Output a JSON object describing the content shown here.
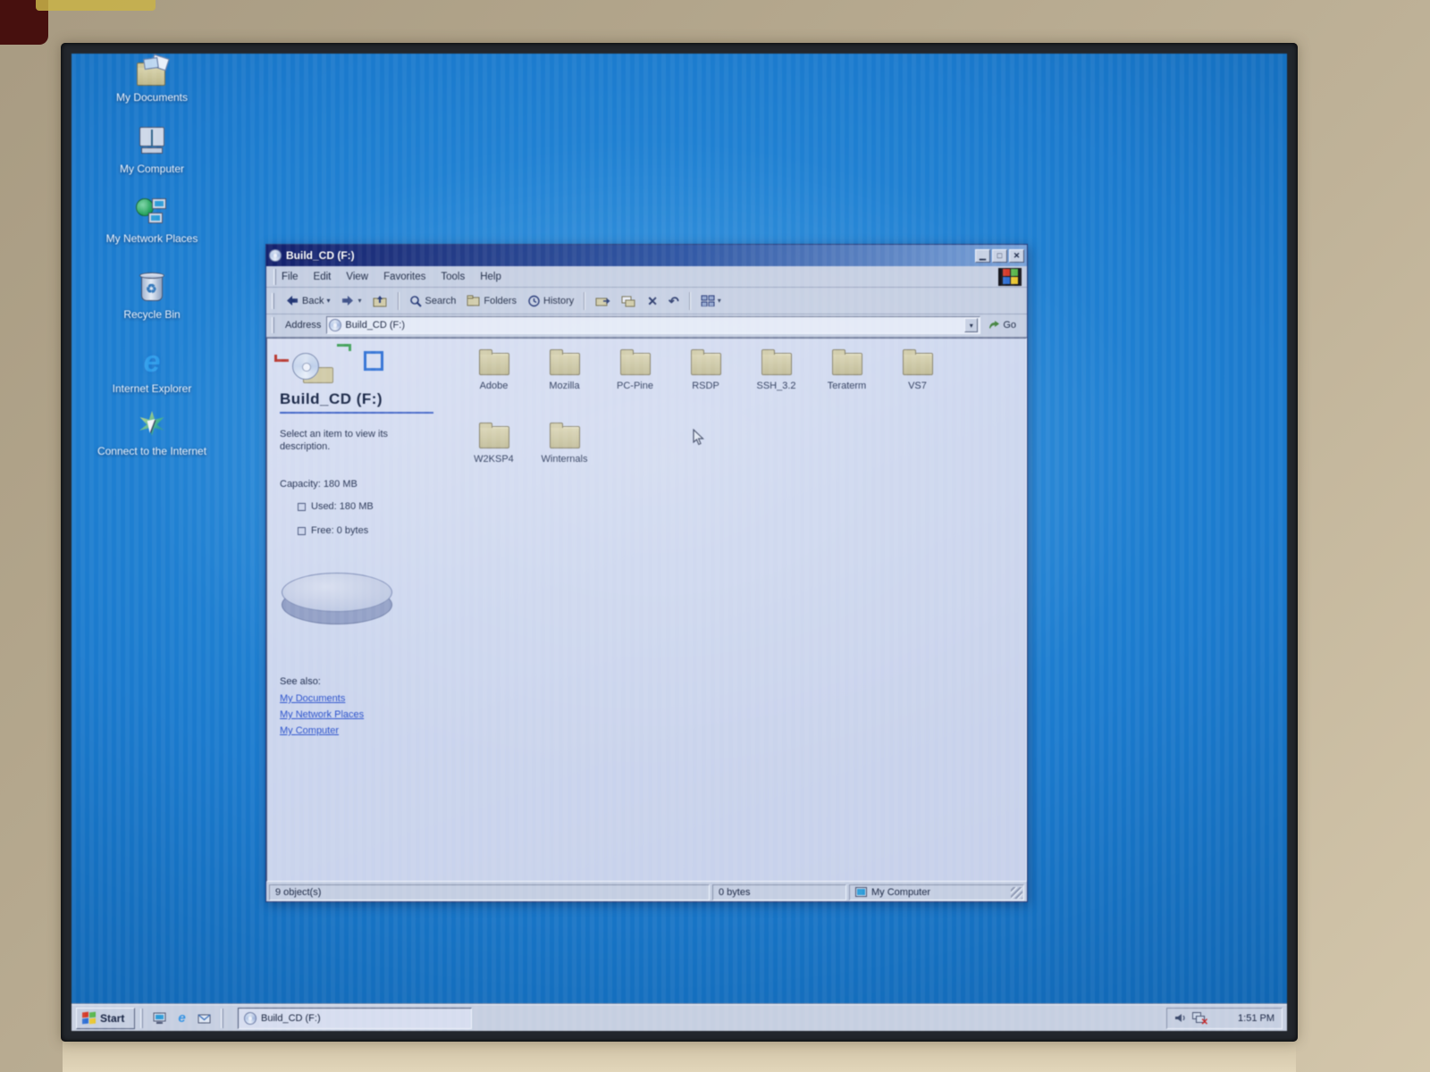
{
  "colors": {
    "desktop_blue": "#1d7acb",
    "titlebar_start": "#13206b",
    "titlebar_end": "#7ba3d8",
    "window_chrome": "#c4cee2",
    "link_blue": "#2a50c8",
    "folder_tan": "#c9c29f"
  },
  "desktop": {
    "icons": [
      {
        "label": "My Documents"
      },
      {
        "label": "My Computer"
      },
      {
        "label": "My Network Places"
      },
      {
        "label": "Recycle Bin"
      },
      {
        "label": "Internet Explorer"
      },
      {
        "label": "Connect to the Internet"
      }
    ]
  },
  "window": {
    "title": "Build_CD (F:)",
    "menus": [
      "File",
      "Edit",
      "View",
      "Favorites",
      "Tools",
      "Help"
    ],
    "toolbar": {
      "back": "Back",
      "search": "Search",
      "folders": "Folders",
      "history": "History"
    },
    "address": {
      "label": "Address",
      "value": "Build_CD (F:)",
      "go": "Go"
    },
    "panel": {
      "title": "Build_CD (F:)",
      "description": "Select an item to view its description.",
      "capacity": "Capacity: 180 MB",
      "used": "Used: 180 MB",
      "free": "Free: 0 bytes",
      "see_also": "See also:",
      "links": [
        "My Documents",
        "My Network Places",
        "My Computer"
      ]
    },
    "folders": [
      "Adobe",
      "Mozilla",
      "PC-Pine",
      "RSDP",
      "SSH_3.2",
      "Teraterm",
      "VS7",
      "W2KSP4",
      "Winternals"
    ],
    "status": {
      "objects": "9 object(s)",
      "size": "0 bytes",
      "location": "My Computer"
    }
  },
  "taskbar": {
    "start": "Start",
    "task": "Build_CD (F:)",
    "time": "1:51 PM"
  }
}
